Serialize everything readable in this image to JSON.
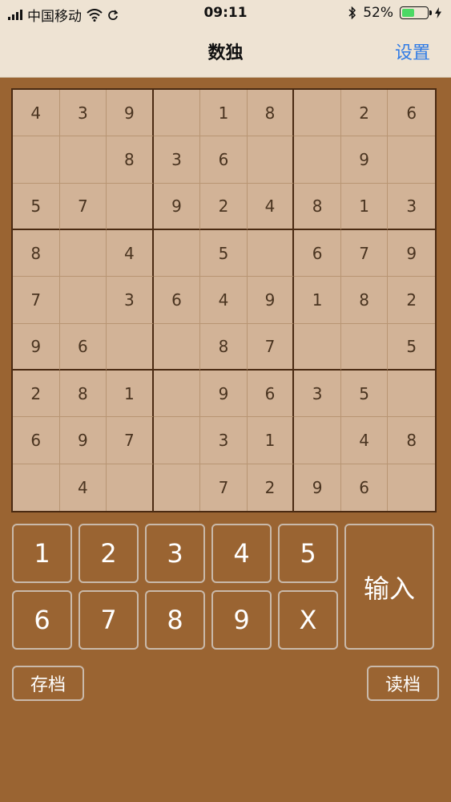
{
  "status_bar": {
    "carrier": "中国移动",
    "time": "09:11",
    "battery_percent": "52%",
    "battery_level": 0.52,
    "icons": [
      "signal-icon",
      "wifi-icon",
      "sync-icon",
      "bluetooth-icon",
      "battery-icon",
      "charging-icon"
    ]
  },
  "nav": {
    "title": "数独",
    "settings_label": "设置"
  },
  "board": [
    [
      "4",
      "3",
      "9",
      "",
      "1",
      "8",
      "",
      "2",
      "6"
    ],
    [
      "",
      "",
      "8",
      "3",
      "6",
      "",
      "",
      "9",
      ""
    ],
    [
      "5",
      "7",
      "",
      "9",
      "2",
      "4",
      "8",
      "1",
      "3"
    ],
    [
      "8",
      "",
      "4",
      "",
      "5",
      "",
      "6",
      "7",
      "9"
    ],
    [
      "7",
      "",
      "3",
      "6",
      "4",
      "9",
      "1",
      "8",
      "2"
    ],
    [
      "9",
      "6",
      "",
      "",
      "8",
      "7",
      "",
      "",
      "5"
    ],
    [
      "2",
      "8",
      "1",
      "",
      "9",
      "6",
      "3",
      "5",
      ""
    ],
    [
      "6",
      "9",
      "7",
      "",
      "3",
      "1",
      "",
      "4",
      "8"
    ],
    [
      "",
      "4",
      "",
      "",
      "7",
      "2",
      "9",
      "6",
      ""
    ]
  ],
  "keypad": {
    "k1": "1",
    "k2": "2",
    "k3": "3",
    "k4": "4",
    "k5": "5",
    "k6": "6",
    "k7": "7",
    "k8": "8",
    "k9": "9",
    "kx": "X",
    "input": "输入"
  },
  "actions": {
    "save": "存档",
    "load": "读档"
  },
  "colors": {
    "background": "#9a6432",
    "board": "#d2b397",
    "bar": "#eee3d3",
    "link": "#2f7be6"
  }
}
